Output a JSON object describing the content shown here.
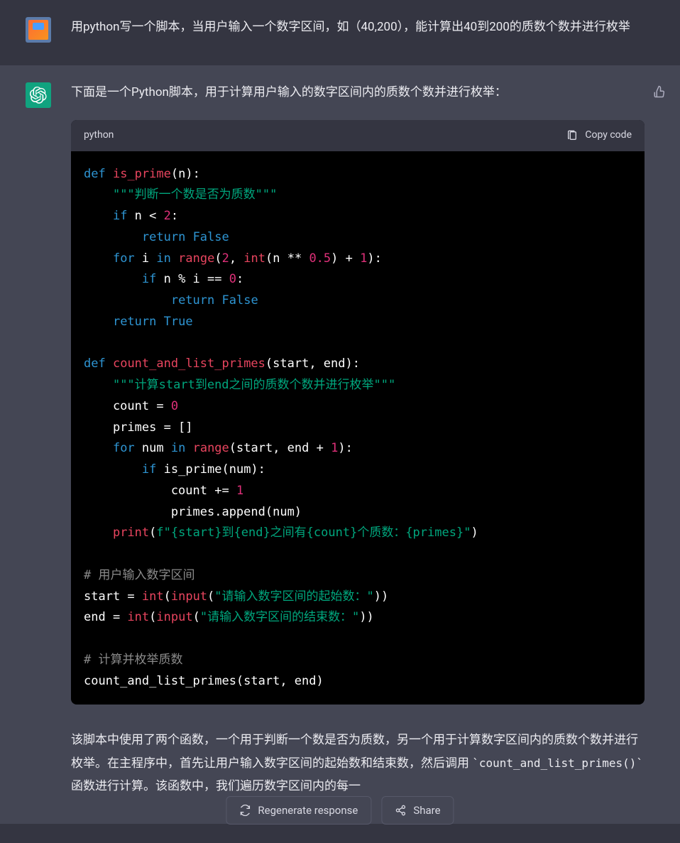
{
  "user": {
    "message": "用python写一个脚本，当用户输入一个数字区间，如（40,200），能计算出40到200的质数个数并进行枚举"
  },
  "assistant": {
    "intro": "下面是一个Python脚本，用于计算用户输入的数字区间内的质数个数并进行枚举：",
    "code_lang": "python",
    "copy_label": "Copy code",
    "explanation_part1": "该脚本中使用了两个函数，一个用于判断一个数是否为质数，另一个用于计算数字区间内的质数个数并进行枚举。在主程序中，首先让用户输入数字区间的起始数和结束数，然后调用 ",
    "explanation_code": "`count_and_list_primes()`",
    "explanation_part2": " 函数进行计算。该函数中，我们遍历数字区间内的每一"
  },
  "code": {
    "l1_def": "def",
    "l1_fn": "is_prime",
    "l1_rest": "(n):",
    "l2_doc": "\"\"\"判断一个数是否为质数\"\"\"",
    "l3_if": "if",
    "l3_cond": " n < ",
    "l3_num": "2",
    "l3_colon": ":",
    "l4_return": "return",
    "l4_val": "False",
    "l5_for": "for",
    "l5_i": " i ",
    "l5_in": "in",
    "l5_sp": " ",
    "l5_range": "range",
    "l5_open": "(",
    "l5_2": "2",
    "l5_comma": ", ",
    "l5_int": "int",
    "l5_nexp": "(n ** ",
    "l5_05": "0.5",
    "l5_close05": ") + ",
    "l5_1": "1",
    "l5_end": "):",
    "l6_if": "if",
    "l6_cond": " n % i == ",
    "l6_0": "0",
    "l6_colon": ":",
    "l7_return": "return",
    "l7_val": "False",
    "l8_return": "return",
    "l8_val": "True",
    "l9_def": "def",
    "l9_fn": "count_and_list_primes",
    "l9_rest": "(start, end):",
    "l10_doc": "\"\"\"计算start到end之间的质数个数并进行枚举\"\"\"",
    "l11_count": "    count = ",
    "l11_0": "0",
    "l12_primes": "    primes = []",
    "l13_for": "for",
    "l13_num": " num ",
    "l13_in": "in",
    "l13_sp": " ",
    "l13_range": "range",
    "l13_args": "(start, end + ",
    "l13_1": "1",
    "l13_end": "):",
    "l14_if": "if",
    "l14_cond": " is_prime(num):",
    "l15_count": "            count += ",
    "l15_1": "1",
    "l16_append": "            primes.append(num)",
    "l17_print": "print",
    "l17_open": "(",
    "l17_f": "f\"{start}到{end}之间有{count}个质数：{primes}\"",
    "l17_close": ")",
    "c1": "# 用户输入数字区间",
    "l18_start": "start = ",
    "l18_int": "int",
    "l18_open": "(",
    "l18_input": "input",
    "l18_open2": "(",
    "l18_str": "\"请输入数字区间的起始数：\"",
    "l18_close": "))",
    "l19_end": "end = ",
    "l19_int": "int",
    "l19_open": "(",
    "l19_input": "input",
    "l19_open2": "(",
    "l19_str": "\"请输入数字区间的结束数：\"",
    "l19_close": "))",
    "c2": "# 计算并枚举质数",
    "l20": "count_and_list_primes(start, end)"
  },
  "buttons": {
    "regenerate": "Regenerate response",
    "share": "Share"
  }
}
